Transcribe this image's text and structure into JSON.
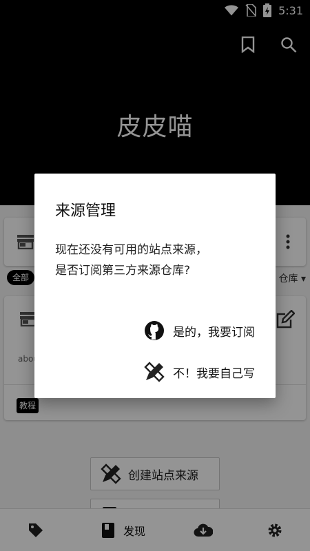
{
  "status_bar": {
    "time": "5:31"
  },
  "header": {
    "app_title": "皮皮喵"
  },
  "content": {
    "chip_all": "全部",
    "repo_filter": "仓库 ▾",
    "repo_about": "abou",
    "tag_tutorial": "教程",
    "create_source_label": "创建站点来源"
  },
  "bottom_nav": {
    "discover_label": "发现"
  },
  "dialog": {
    "title": "来源管理",
    "message_line1": "现在还没有可用的站点来源，",
    "message_line2": "是否订阅第三方来源仓库?",
    "subscribe_label": "是的，我要订阅",
    "self_label": "不！我要自己写"
  }
}
